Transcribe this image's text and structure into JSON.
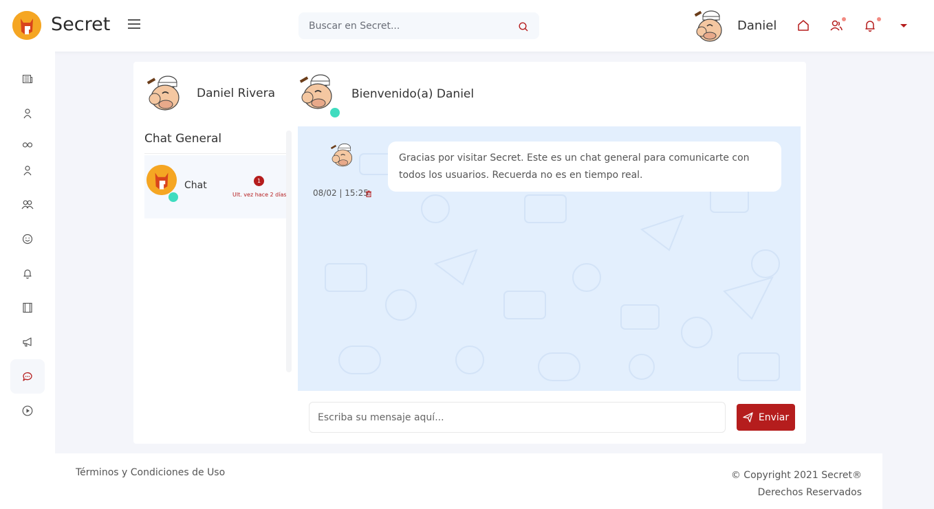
{
  "brand": {
    "name": "Secret",
    "logo_color": "#f5a623",
    "accent": "#b51d1d"
  },
  "header": {
    "search_placeholder": "Buscar en Secret...",
    "user_name": "Daniel",
    "icons": [
      "home-icon",
      "users-icon",
      "bell-icon",
      "chevron-down-icon"
    ]
  },
  "sidebar": {
    "items": [
      {
        "icon": "newspaper-icon"
      },
      {
        "icon": "user-icon"
      },
      {
        "icon": "infinity-icon"
      },
      {
        "icon": "user-icon"
      },
      {
        "icon": "users-icon"
      },
      {
        "icon": "smile-icon"
      },
      {
        "icon": "bell-icon"
      },
      {
        "icon": "film-icon"
      },
      {
        "icon": "megaphone-icon"
      },
      {
        "icon": "chat-icon",
        "active": true
      },
      {
        "icon": "play-circle-icon"
      }
    ]
  },
  "chat": {
    "profile_name": "Daniel Rivera",
    "welcome": "Bienvenido(a) Daniel",
    "list_title": "Chat General",
    "items": [
      {
        "name": "Chat",
        "unread": "1",
        "last_seen": "Ult. vez hace 2 días"
      }
    ],
    "messages": [
      {
        "text": "Gracias por visitar Secret. Este es un chat general para comunicarte con todos los usuarios. Recuerda no es en tiempo real.",
        "time": "08/02 | 15:25"
      }
    ],
    "input_placeholder": "Escriba su mensaje aquí...",
    "send_label": "Enviar"
  },
  "footer": {
    "terms": "Términos y Condiciones de Uso",
    "copyright": "© Copyright 2021 Secret®",
    "rights": "Derechos Reservados"
  }
}
